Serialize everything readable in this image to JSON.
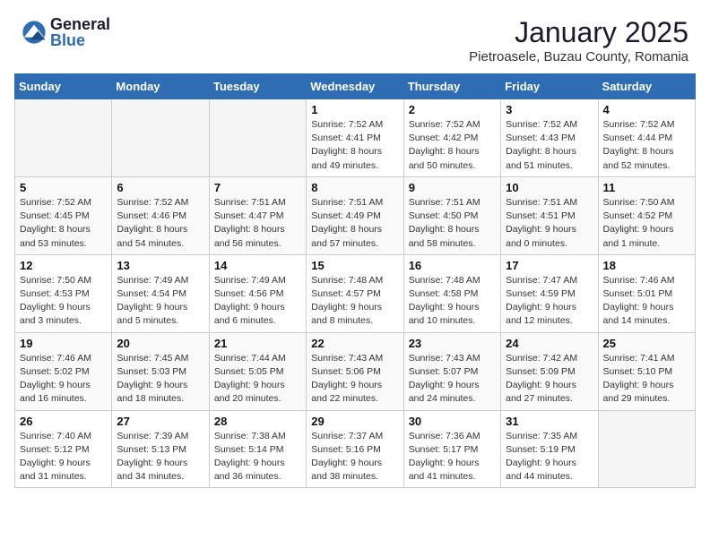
{
  "header": {
    "logo_general": "General",
    "logo_blue": "Blue",
    "month_year": "January 2025",
    "location": "Pietroasele, Buzau County, Romania"
  },
  "weekdays": [
    "Sunday",
    "Monday",
    "Tuesday",
    "Wednesday",
    "Thursday",
    "Friday",
    "Saturday"
  ],
  "weeks": [
    [
      {
        "day": "",
        "empty": true
      },
      {
        "day": "",
        "empty": true
      },
      {
        "day": "",
        "empty": true
      },
      {
        "day": "1",
        "sunrise": "7:52 AM",
        "sunset": "4:41 PM",
        "daylight": "8 hours and 49 minutes."
      },
      {
        "day": "2",
        "sunrise": "7:52 AM",
        "sunset": "4:42 PM",
        "daylight": "8 hours and 50 minutes."
      },
      {
        "day": "3",
        "sunrise": "7:52 AM",
        "sunset": "4:43 PM",
        "daylight": "8 hours and 51 minutes."
      },
      {
        "day": "4",
        "sunrise": "7:52 AM",
        "sunset": "4:44 PM",
        "daylight": "8 hours and 52 minutes."
      }
    ],
    [
      {
        "day": "5",
        "sunrise": "7:52 AM",
        "sunset": "4:45 PM",
        "daylight": "8 hours and 53 minutes."
      },
      {
        "day": "6",
        "sunrise": "7:52 AM",
        "sunset": "4:46 PM",
        "daylight": "8 hours and 54 minutes."
      },
      {
        "day": "7",
        "sunrise": "7:51 AM",
        "sunset": "4:47 PM",
        "daylight": "8 hours and 56 minutes."
      },
      {
        "day": "8",
        "sunrise": "7:51 AM",
        "sunset": "4:49 PM",
        "daylight": "8 hours and 57 minutes."
      },
      {
        "day": "9",
        "sunrise": "7:51 AM",
        "sunset": "4:50 PM",
        "daylight": "8 hours and 58 minutes."
      },
      {
        "day": "10",
        "sunrise": "7:51 AM",
        "sunset": "4:51 PM",
        "daylight": "9 hours and 0 minutes."
      },
      {
        "day": "11",
        "sunrise": "7:50 AM",
        "sunset": "4:52 PM",
        "daylight": "9 hours and 1 minute."
      }
    ],
    [
      {
        "day": "12",
        "sunrise": "7:50 AM",
        "sunset": "4:53 PM",
        "daylight": "9 hours and 3 minutes."
      },
      {
        "day": "13",
        "sunrise": "7:49 AM",
        "sunset": "4:54 PM",
        "daylight": "9 hours and 5 minutes."
      },
      {
        "day": "14",
        "sunrise": "7:49 AM",
        "sunset": "4:56 PM",
        "daylight": "9 hours and 6 minutes."
      },
      {
        "day": "15",
        "sunrise": "7:48 AM",
        "sunset": "4:57 PM",
        "daylight": "9 hours and 8 minutes."
      },
      {
        "day": "16",
        "sunrise": "7:48 AM",
        "sunset": "4:58 PM",
        "daylight": "9 hours and 10 minutes."
      },
      {
        "day": "17",
        "sunrise": "7:47 AM",
        "sunset": "4:59 PM",
        "daylight": "9 hours and 12 minutes."
      },
      {
        "day": "18",
        "sunrise": "7:46 AM",
        "sunset": "5:01 PM",
        "daylight": "9 hours and 14 minutes."
      }
    ],
    [
      {
        "day": "19",
        "sunrise": "7:46 AM",
        "sunset": "5:02 PM",
        "daylight": "9 hours and 16 minutes."
      },
      {
        "day": "20",
        "sunrise": "7:45 AM",
        "sunset": "5:03 PM",
        "daylight": "9 hours and 18 minutes."
      },
      {
        "day": "21",
        "sunrise": "7:44 AM",
        "sunset": "5:05 PM",
        "daylight": "9 hours and 20 minutes."
      },
      {
        "day": "22",
        "sunrise": "7:43 AM",
        "sunset": "5:06 PM",
        "daylight": "9 hours and 22 minutes."
      },
      {
        "day": "23",
        "sunrise": "7:43 AM",
        "sunset": "5:07 PM",
        "daylight": "9 hours and 24 minutes."
      },
      {
        "day": "24",
        "sunrise": "7:42 AM",
        "sunset": "5:09 PM",
        "daylight": "9 hours and 27 minutes."
      },
      {
        "day": "25",
        "sunrise": "7:41 AM",
        "sunset": "5:10 PM",
        "daylight": "9 hours and 29 minutes."
      }
    ],
    [
      {
        "day": "26",
        "sunrise": "7:40 AM",
        "sunset": "5:12 PM",
        "daylight": "9 hours and 31 minutes."
      },
      {
        "day": "27",
        "sunrise": "7:39 AM",
        "sunset": "5:13 PM",
        "daylight": "9 hours and 34 minutes."
      },
      {
        "day": "28",
        "sunrise": "7:38 AM",
        "sunset": "5:14 PM",
        "daylight": "9 hours and 36 minutes."
      },
      {
        "day": "29",
        "sunrise": "7:37 AM",
        "sunset": "5:16 PM",
        "daylight": "9 hours and 38 minutes."
      },
      {
        "day": "30",
        "sunrise": "7:36 AM",
        "sunset": "5:17 PM",
        "daylight": "9 hours and 41 minutes."
      },
      {
        "day": "31",
        "sunrise": "7:35 AM",
        "sunset": "5:19 PM",
        "daylight": "9 hours and 44 minutes."
      },
      {
        "day": "",
        "empty": true
      }
    ]
  ]
}
